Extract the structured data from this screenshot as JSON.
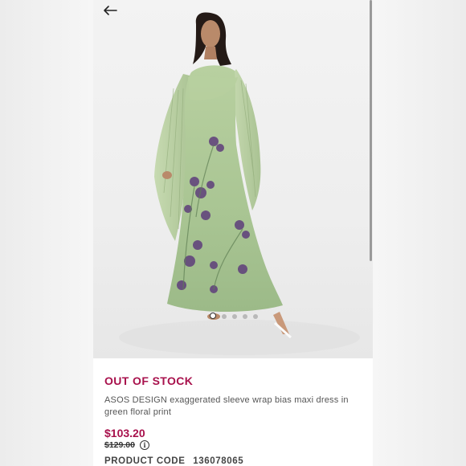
{
  "header": {
    "back_icon": "arrow-left-icon"
  },
  "product": {
    "stock_status": "OUT OF STOCK",
    "title": "ASOS DESIGN exaggerated sleeve wrap bias maxi dress in green floral print",
    "price": "$103.20",
    "was_price": "$129.00",
    "info_icon_glyph": "i",
    "product_code_label": "PRODUCT CODE",
    "product_code": "136078065"
  },
  "gallery": {
    "image_count": 5,
    "active_index": 0
  },
  "colors": {
    "accent": "#a8114c",
    "dress_green": "#a9c593",
    "flower_purple": "#5e3e7b"
  }
}
